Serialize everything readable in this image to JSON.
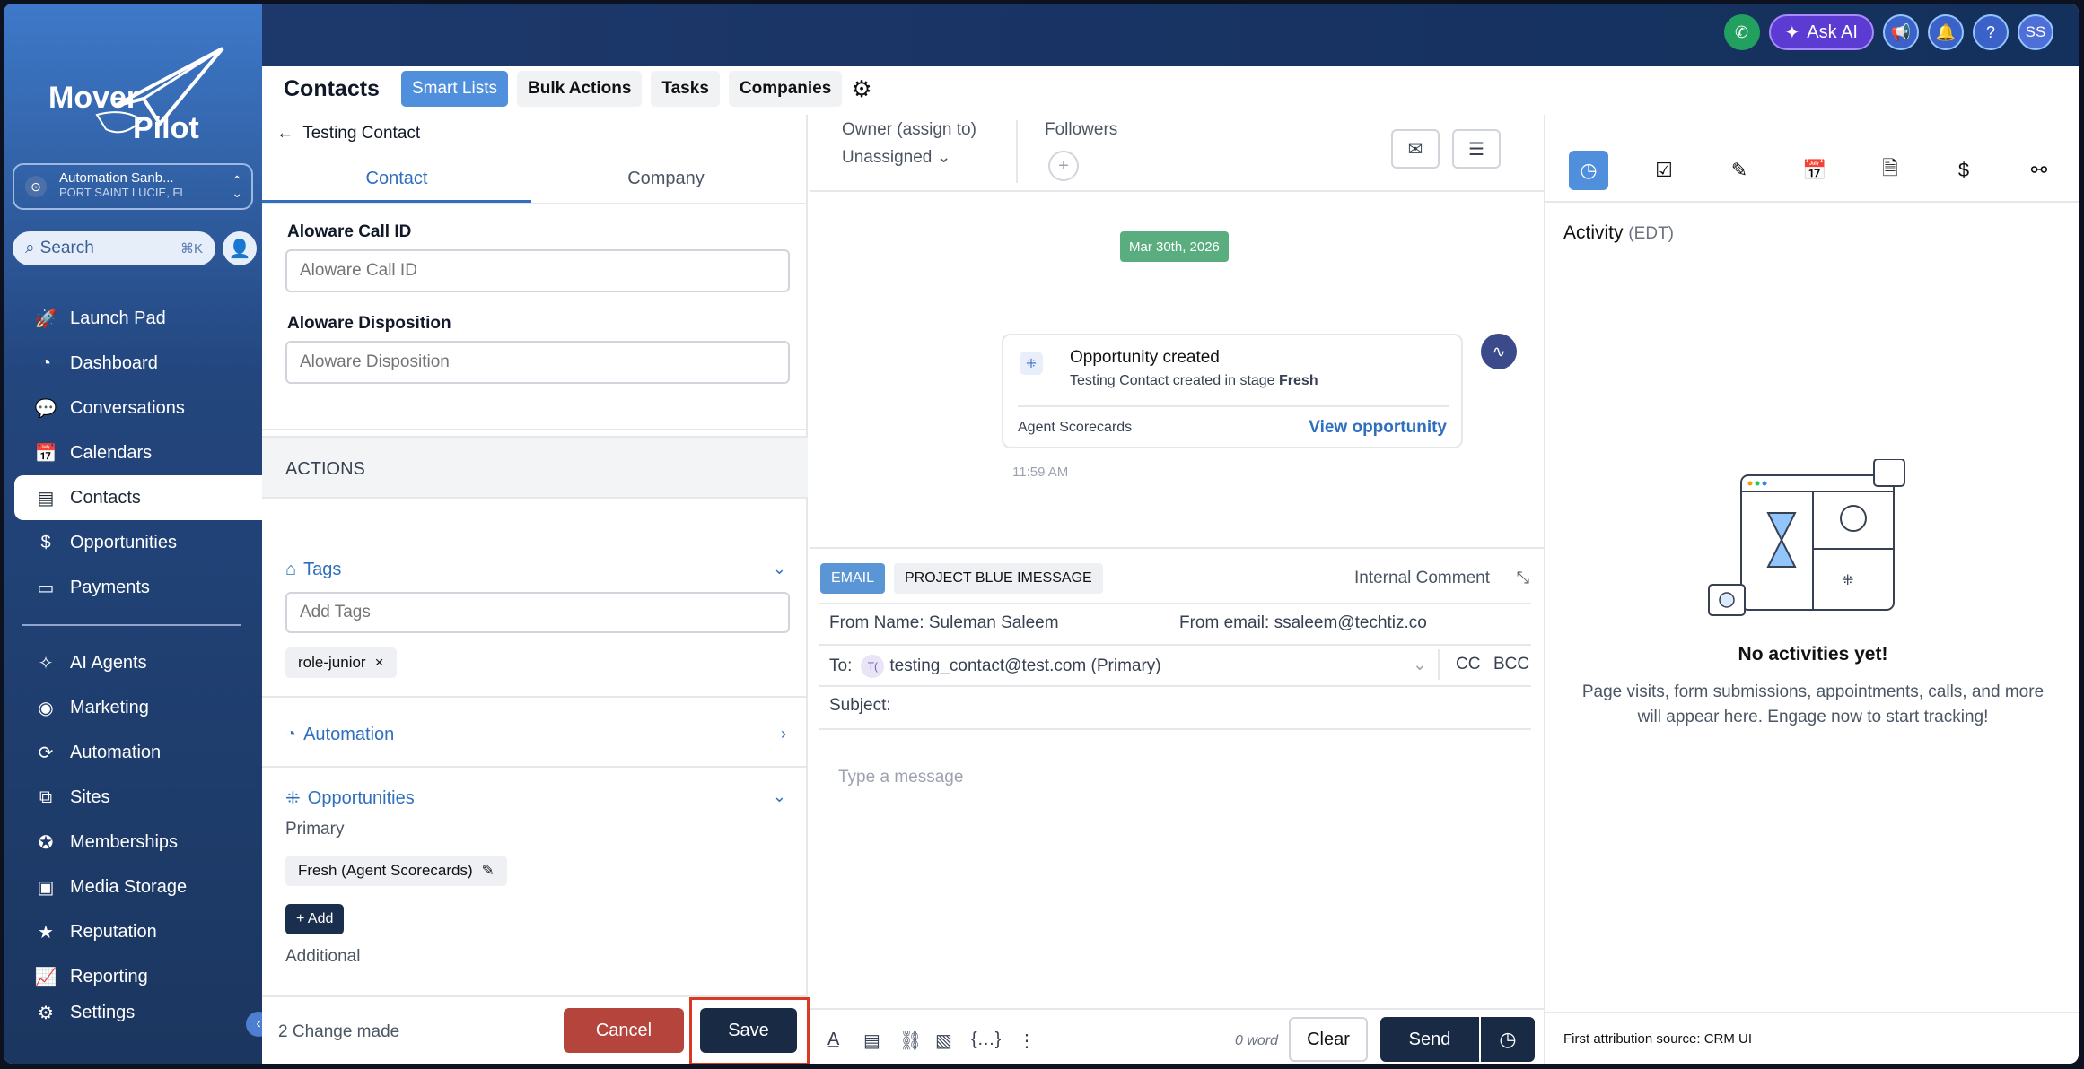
{
  "topbar": {
    "ask_ai_label": "Ask AI",
    "user_initials": "SS",
    "help_label": "?"
  },
  "sidebar": {
    "logo_word1": "Mover",
    "logo_word2": "Pilot",
    "location_name": "Automation Sanb...",
    "location_sub": "PORT SAINT LUCIE, FL",
    "search_placeholder": "Search",
    "search_shortcut": "⌘K",
    "items": [
      {
        "label": "Launch Pad",
        "icon": "rocket-icon"
      },
      {
        "label": "Dashboard",
        "icon": "gauge-icon"
      },
      {
        "label": "Conversations",
        "icon": "chat-icon"
      },
      {
        "label": "Calendars",
        "icon": "calendar-icon"
      },
      {
        "label": "Contacts",
        "icon": "contacts-icon",
        "active": true
      },
      {
        "label": "Opportunities",
        "icon": "opportunities-icon"
      },
      {
        "label": "Payments",
        "icon": "payments-icon"
      }
    ],
    "items2": [
      {
        "label": "AI Agents",
        "icon": "ai-agents-icon"
      },
      {
        "label": "Marketing",
        "icon": "marketing-icon"
      },
      {
        "label": "Automation",
        "icon": "automation-icon"
      },
      {
        "label": "Sites",
        "icon": "sites-icon"
      },
      {
        "label": "Memberships",
        "icon": "memberships-icon"
      },
      {
        "label": "Media Storage",
        "icon": "media-icon"
      },
      {
        "label": "Reputation",
        "icon": "reputation-icon"
      },
      {
        "label": "Reporting",
        "icon": "reporting-icon"
      },
      {
        "label": "Settings",
        "icon": "settings-icon"
      }
    ]
  },
  "header": {
    "title": "Contacts",
    "tabs": [
      "Smart Lists",
      "Bulk Actions",
      "Tasks",
      "Companies"
    ]
  },
  "left": {
    "breadcrumb": "Testing Contact",
    "subtabs": [
      "Contact",
      "Company"
    ],
    "fields": [
      {
        "label": "Aloware Call ID",
        "placeholder": "Aloware Call ID"
      },
      {
        "label": "Aloware Disposition",
        "placeholder": "Aloware Disposition"
      }
    ],
    "actions_header": "ACTIONS",
    "tags_title": "Tags",
    "tags_placeholder": "Add Tags",
    "tag_chip": "role-junior",
    "automation_title": "Automation",
    "opportunities_title": "Opportunities",
    "primary_label": "Primary",
    "opp_chip": "Fresh (Agent Scorecards)",
    "add_label": "+ Add",
    "additional_label": "Additional",
    "changes_text": "2 Change made",
    "cancel_label": "Cancel",
    "save_label": "Save"
  },
  "center": {
    "owner_label": "Owner (assign to)",
    "owner_value": "Unassigned",
    "followers_label": "Followers",
    "date_badge": "Mar 30th, 2026",
    "opp_title": "Opportunity created",
    "opp_desc_prefix": "Testing Contact created in stage ",
    "opp_stage": "Fresh",
    "opp_pipeline": "Agent Scorecards",
    "opp_link": "View opportunity",
    "opp_time": "11:59 AM",
    "composer": {
      "tab_email": "EMAIL",
      "tab_pb": "PROJECT BLUE IMESSAGE",
      "internal": "Internal Comment",
      "from_name_label": "From Name:",
      "from_name": "Suleman Saleem",
      "from_email_label": "From email:",
      "from_email": "ssaleem@techtiz.co",
      "to_label": "To:",
      "to_initial": "T(",
      "to_value": "testing_contact@test.com (Primary)",
      "cc": "CC",
      "bcc": "BCC",
      "subject_label": "Subject:",
      "message_placeholder": "Type a message",
      "word_count": "0 word",
      "clear_label": "Clear",
      "send_label": "Send"
    }
  },
  "right": {
    "activity_title": "Activity",
    "activity_tz": "(EDT)",
    "empty_title": "No activities yet!",
    "empty_sub": "Page visits, form submissions, appointments, calls, and more will appear here. Engage now to start tracking!",
    "attribution": "First attribution source: CRM UI"
  },
  "colors": {
    "accent": "#4f8fdc",
    "primary_dark": "#182a44",
    "danger": "#b5443d",
    "success": "#5aad7e"
  }
}
